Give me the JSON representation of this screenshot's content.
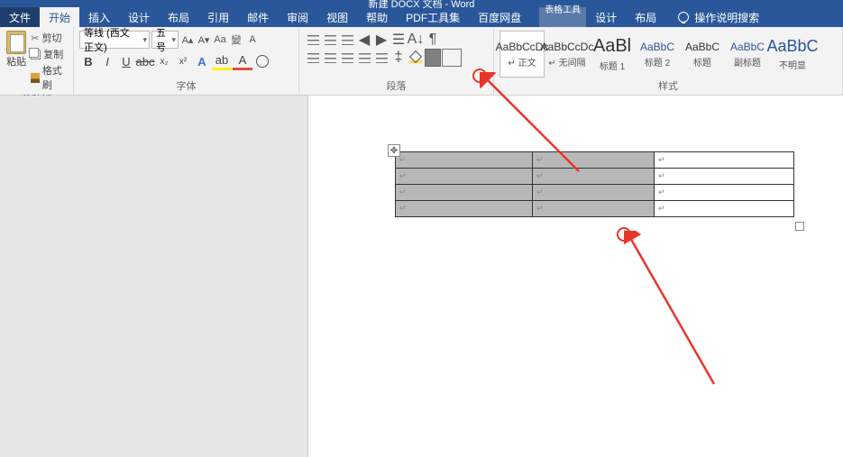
{
  "title": "新建 DOCX 文档 - Word",
  "context_tab_group": "表格工具",
  "tabs": {
    "file": "文件",
    "home": "开始",
    "insert": "插入",
    "design": "设计",
    "layout": "布局",
    "references": "引用",
    "mailings": "邮件",
    "review": "审阅",
    "view": "视图",
    "help": "帮助",
    "pdf_tools": "PDF工具集",
    "baidu": "百度网盘",
    "table_design": "设计",
    "table_layout": "布局"
  },
  "tell_me": "操作说明搜索",
  "clipboard": {
    "paste": "粘贴",
    "cut": "剪切",
    "copy": "复制",
    "format_painter": "格式刷",
    "group": "剪贴板"
  },
  "font": {
    "name": "等线 (西文正文)",
    "size": "五号",
    "group": "字体"
  },
  "paragraph": {
    "group": "段落"
  },
  "styles": {
    "group": "样式",
    "items": [
      {
        "preview": "AaBbCcDc",
        "name": "↵ 正文"
      },
      {
        "preview": "AaBbCcDc",
        "name": "↵ 无间隔"
      },
      {
        "preview": "AaBl",
        "name": "标题 1"
      },
      {
        "preview": "AaBbC",
        "name": "标题 2"
      },
      {
        "preview": "AaBbC",
        "name": "标题"
      },
      {
        "preview": "AaBbC",
        "name": "副标题"
      },
      {
        "preview": "AaBbC",
        "name": "不明显"
      }
    ]
  },
  "table": {
    "rows": 4,
    "cols": 3,
    "cell_mark": "↵"
  }
}
